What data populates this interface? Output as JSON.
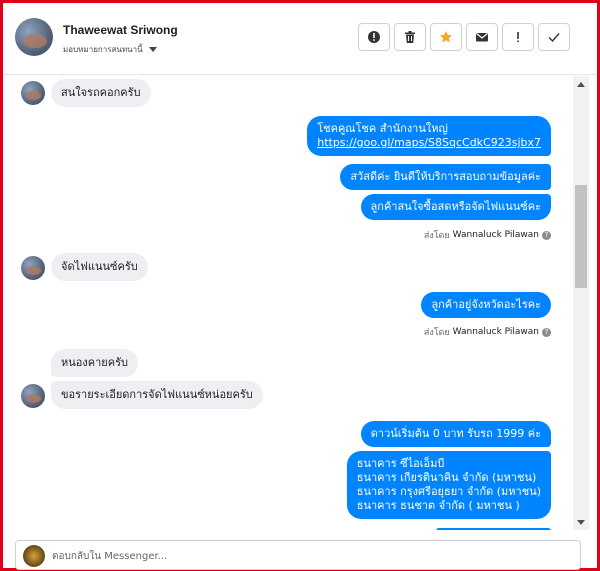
{
  "header": {
    "contact_name": "Thaweewat Sriwong",
    "assign_label": "มอบหมายการสนทนานี้",
    "tools": [
      {
        "icon": "alert-circle-icon"
      },
      {
        "icon": "trash-icon"
      },
      {
        "icon": "star-icon"
      },
      {
        "icon": "mail-icon"
      },
      {
        "icon": "exclamation-icon"
      },
      {
        "icon": "check-icon"
      }
    ]
  },
  "colors": {
    "frame_border": "#e0001a",
    "outgoing_bubble": "#0084ff",
    "incoming_bubble": "#eeeff2",
    "star": "#f5a623"
  },
  "messages": {
    "m1": "สนใจรถคอกครับ",
    "m2_line1": "โชคคูณโชค สำนักงานใหญ่",
    "m2_link": "https://goo.gl/maps/S8SqcCdkC923sjbx7",
    "m3": "สวัสดีค่ะ  ยินดีให้บริการสอบถามข้อมูลค่ะ",
    "m4": "ลูกค้าสนใจซื้อสดหรือจัดไฟแนนซ์คะ",
    "m5": "จัดไฟแนนซ์ครับ",
    "m6": "ลูกค้าอยู่จังหวัดอะไรคะ",
    "m7": "หนองคายครับ",
    "m8": "ขอรายระเอียดการจัดไฟแนนซ์หน่อยครับ",
    "m9": "ดาวน์เริ่มต้น 0 บาท รับรถ 1999 ค่ะ",
    "m10_lines": [
      "ธนาคาร ซีไอเอ็มบี",
      "ธนาคาร เกียรตินาคิน จำกัด (มหาชน)",
      "ธนาคาร กรุงศรีอยุธยา จำกัด (มหาชน)",
      "ธนาคาร ธนชาต จำกัด ( มหาชน )"
    ]
  },
  "sent_by": {
    "prefix": "ส่งโดย",
    "agent": "Wannaluck Pilawan",
    "help": "?"
  },
  "composer": {
    "placeholder": "ตอบกลับใน Messenger..."
  }
}
